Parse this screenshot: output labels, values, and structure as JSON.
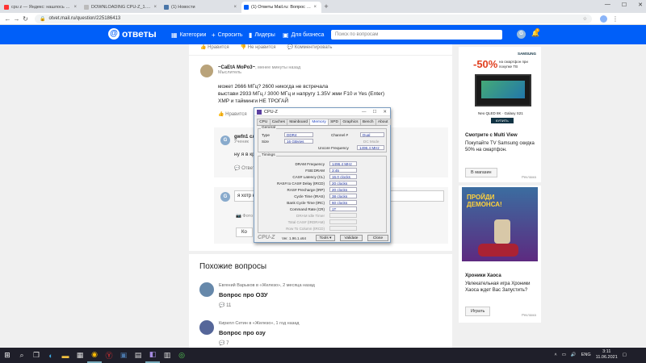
{
  "browser": {
    "tabs": [
      {
        "title": "cpu z — Яндекс: нашлось 2 млн",
        "color": "#ff3333",
        "active": false
      },
      {
        "title": "DOWNLOADING CPU-Z_1.96-EN",
        "color": "#bbbbbb",
        "active": false
      },
      {
        "title": "(1) Новости",
        "color": "#4a76a8",
        "active": false
      },
      {
        "title": "(1) Ответы Mail.ru: Вопрос про",
        "color": "#005ff9",
        "active": true
      }
    ],
    "new_tab": "+",
    "url": "otvet.mail.ru/question/225186413"
  },
  "site": {
    "logo": "ответы",
    "nav": [
      {
        "icon": "grid-icon",
        "label": "Категории"
      },
      {
        "icon": "plus-icon",
        "label": "Спросить"
      },
      {
        "icon": "leaders-icon",
        "label": "Лидеры"
      },
      {
        "icon": "business-icon",
        "label": "Для бизнеса"
      }
    ],
    "search_placeholder": "Поиск по вопросам",
    "user_initial": "G",
    "notif_count": "1"
  },
  "prev_actions": {
    "like": "Нравится",
    "dislike": "Не нравится",
    "comment": "Комментировать"
  },
  "answer": {
    "author": "~CaEtA MoPo3~",
    "time": ", менее минуты назад",
    "rank": "Мыслитель",
    "lines": [
      "может 2666 МГц? 2600 никогда не встречала",
      "выстави 2933 МГц / 3000 МГц и напругу 1.35V жми F10 и Yes (Enter)",
      "XMP и тайминги НЕ ТРОГАЙ"
    ],
    "like": "Нравится",
    "dislike": "Не нравится",
    "comment": "Комментировать"
  },
  "comment": {
    "initial": "G",
    "author": "gwfn1 сл",
    "rank": "Ученик",
    "text": "ну я в кр",
    "reply": "Ответить"
  },
  "reply_box": {
    "initial": "G",
    "placeholder": "я хотр к",
    "photo": "Фото",
    "reply": "Ответить",
    "comment_btn": "Ко"
  },
  "similar": {
    "heading": "Похожие вопросы",
    "items": [
      {
        "author": "Евгений Варыков в «Железо», 2 месяца назад",
        "question": "Вопрос про ОЗУ",
        "count": "11",
        "reply": "Ответить"
      },
      {
        "author": "Кирилл Сетин в «Железо», 1 год назад",
        "question": "Вопрос про озу",
        "count": "7",
        "reply": "Ответить"
      }
    ]
  },
  "ads": {
    "brand": "SAMSUNG",
    "discount": "-50%",
    "promo": "на смартфон при покупке ТВ",
    "product": "Neo QLED 8K · Galaxy S21",
    "buy": "КУПИТЬ",
    "title": "Смотрите с Multi View",
    "desc": "Покупайте TV Samsung скидка 50% на смартфон.",
    "shop_btn": "В магазин",
    "ad_label": "Реклама",
    "game_banner": "ПРОЙДИ ДЕМОНСА!",
    "game_title": "Хроники Хаоса",
    "game_desc": "Увлекательная игра Хроники Хаоса ждет Вас Запустить?",
    "play_btn": "Играть",
    "ad_label2": "Реклама"
  },
  "cpuz": {
    "title": "CPU-Z",
    "tabs": [
      "CPU",
      "Caches",
      "Mainboard",
      "Memory",
      "SPD",
      "Graphics",
      "Bench",
      "About"
    ],
    "active_tab": "Memory",
    "general_label": "General",
    "type_label": "Type",
    "type": "DDR4",
    "size_label": "Size",
    "size": "16 GBytes",
    "channel_label": "Channel #",
    "channel": "Dual",
    "dc_label": "DC Mode",
    "uncore_label": "Uncore Frequency",
    "uncore": "1496.4 MHz",
    "timings_label": "Timings",
    "timings": [
      {
        "label": "DRAM Frequency",
        "value": "1496.4 MHz",
        "enabled": true
      },
      {
        "label": "FSB:DRAM",
        "value": "3:45",
        "enabled": true
      },
      {
        "label": "CAS# Latency (CL)",
        "value": "16.0 clocks",
        "enabled": true
      },
      {
        "label": "RAS# to CAS# Delay (tRCD)",
        "value": "20 clocks",
        "enabled": true
      },
      {
        "label": "RAS# Precharge (tRP)",
        "value": "20 clocks",
        "enabled": true
      },
      {
        "label": "Cycle Time (tRAS)",
        "value": "38 clocks",
        "enabled": true
      },
      {
        "label": "Bank Cycle Time (tRC)",
        "value": "60 clocks",
        "enabled": true
      },
      {
        "label": "Command Rate (CR)",
        "value": "1T",
        "enabled": true
      },
      {
        "label": "DRAM Idle Timer",
        "value": "",
        "enabled": false
      },
      {
        "label": "Total CAS# (tRDRAM)",
        "value": "",
        "enabled": false
      },
      {
        "label": "Row To Column (tRCD)",
        "value": "",
        "enabled": false
      }
    ],
    "logo": "CPU-Z",
    "version": "Ver. 1.96.1.x64",
    "tools": "Tools",
    "validate": "Validate",
    "close": "Close"
  },
  "taskbar": {
    "lang": "ENG",
    "time": "3:11",
    "date": "11.06.2021"
  }
}
